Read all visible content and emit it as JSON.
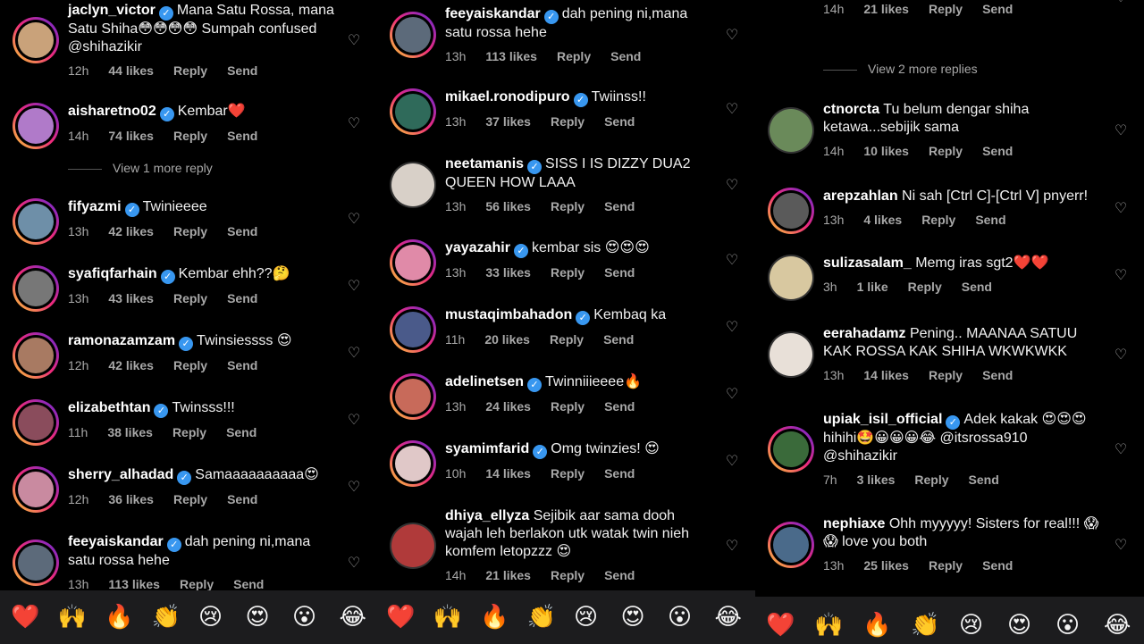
{
  "columns": [
    {
      "comments": [
        {
          "username": "jaclyn_victor",
          "verified": true,
          "text": "Mana Satu Rossa, mana Satu Shiha😳😳😳😳 Sumpah confused @shihazikir",
          "time": "12h",
          "likes": "44 likes",
          "reply": "Reply",
          "send": "Send",
          "avatar_color": "#c9a27a"
        },
        {
          "username": "aisharetno02",
          "verified": true,
          "text": "Kembar❤️",
          "time": "14h",
          "likes": "74 likes",
          "reply": "Reply",
          "send": "Send",
          "avatar_color": "#b07ac9"
        },
        {
          "more_replies": "View 1 more reply"
        },
        {
          "username": "fifyazmi",
          "verified": true,
          "text": "Twinieeee",
          "time": "13h",
          "likes": "42 likes",
          "reply": "Reply",
          "send": "Send",
          "avatar_color": "#6e8fa8"
        },
        {
          "username": "syafiqfarhain",
          "verified": true,
          "text": "Kembar ehh??🤔",
          "time": "13h",
          "likes": "43 likes",
          "reply": "Reply",
          "send": "Send",
          "avatar_color": "#777777"
        },
        {
          "username": "ramonazamzam",
          "verified": true,
          "text": "Twinsiessss 😍",
          "time": "12h",
          "likes": "42 likes",
          "reply": "Reply",
          "send": "Send",
          "avatar_color": "#a87a62"
        },
        {
          "username": "elizabethtan",
          "verified": true,
          "text": "Twinsss!!!",
          "time": "11h",
          "likes": "38 likes",
          "reply": "Reply",
          "send": "Send",
          "avatar_color": "#8a4c5c"
        },
        {
          "username": "sherry_alhadad",
          "verified": true,
          "text": "Samaaaaaaaaaa😍",
          "time": "12h",
          "likes": "36 likes",
          "reply": "Reply",
          "send": "Send",
          "avatar_color": "#c98aa0"
        },
        {
          "username": "feeyaiskandar",
          "verified": true,
          "text": "dah pening ni,mana satu rossa hehe",
          "time": "13h",
          "likes": "113 likes",
          "reply": "Reply",
          "send": "Send",
          "avatar_color": "#5c6a7a"
        }
      ]
    },
    {
      "comments": [
        {
          "username": "feeyaiskandar",
          "verified": true,
          "text": "dah pening ni,mana satu rossa hehe",
          "time": "13h",
          "likes": "113 likes",
          "reply": "Reply",
          "send": "Send",
          "avatar_color": "#5c6a7a"
        },
        {
          "username": "mikael.ronodipuro",
          "verified": true,
          "text": "Twiinss!!",
          "time": "13h",
          "likes": "37 likes",
          "reply": "Reply",
          "send": "Send",
          "avatar_color": "#2f6a5a"
        },
        {
          "username": "neetamanis",
          "verified": true,
          "text": "SISS I IS DIZZY DUA2 QUEEN HOW LAAA",
          "time": "13h",
          "likes": "56 likes",
          "reply": "Reply",
          "send": "Send",
          "avatar_color": "#d8d0c8",
          "plain": true
        },
        {
          "username": "yayazahir",
          "verified": true,
          "text": "kembar sis 😍😍😍",
          "time": "13h",
          "likes": "33 likes",
          "reply": "Reply",
          "send": "Send",
          "avatar_color": "#e08aa8"
        },
        {
          "username": "mustaqimbahadon",
          "verified": true,
          "text": "Kembaq ka",
          "time": "11h",
          "likes": "20 likes",
          "reply": "Reply",
          "send": "Send",
          "avatar_color": "#4a5a8a"
        },
        {
          "username": "adelinetsen",
          "verified": true,
          "text": "Twinniiieeee🔥",
          "time": "13h",
          "likes": "24 likes",
          "reply": "Reply",
          "send": "Send",
          "avatar_color": "#c86a5a"
        },
        {
          "username": "syamimfarid",
          "verified": true,
          "text": "Omg twinzies! 😍",
          "time": "10h",
          "likes": "14 likes",
          "reply": "Reply",
          "send": "Send",
          "avatar_color": "#e0c8c8"
        },
        {
          "username": "dhiya_ellyza",
          "verified": false,
          "text": "Sejibik aar sama dooh wajah leh berlakon utk watak twin nieh komfem letopzzz 😍",
          "time": "14h",
          "likes": "21 likes",
          "reply": "Reply",
          "send": "Send",
          "avatar_color": "#b03a3a",
          "plain": true
        }
      ]
    },
    {
      "comments": [
        {
          "username": "",
          "verified": false,
          "text": "komfem letopzzz 😍",
          "time": "14h",
          "likes": "21 likes",
          "reply": "Reply",
          "send": "Send"
        },
        {
          "more_replies": "View 2 more replies"
        },
        {
          "username": "ctnorcta",
          "verified": false,
          "text": "Tu belum dengar shiha ketawa...sebijik sama",
          "time": "14h",
          "likes": "10 likes",
          "reply": "Reply",
          "send": "Send",
          "avatar_color": "#6a8a5a",
          "plain": true
        },
        {
          "username": "arepzahlan",
          "verified": false,
          "text": "Ni sah [Ctrl C]-[Ctrl V] pnyerr!",
          "time": "13h",
          "likes": "4 likes",
          "reply": "Reply",
          "send": "Send",
          "avatar_color": "#5a5a5a"
        },
        {
          "username": "sulizasalam_",
          "verified": false,
          "text": "Memg iras sgt2❤️❤️",
          "time": "3h",
          "likes": "1 like",
          "reply": "Reply",
          "send": "Send",
          "avatar_color": "#d8c8a0",
          "plain": true
        },
        {
          "username": "eerahadamz",
          "verified": false,
          "text": "Pening.. MAANAA SATUU KAK ROSSA KAK SHIHA WKWKWKK",
          "time": "13h",
          "likes": "14 likes",
          "reply": "Reply",
          "send": "Send",
          "avatar_color": "#e8e0d8",
          "plain": true
        },
        {
          "username": "upiak_isil_official",
          "verified": true,
          "text": "Adek kakak 😍😍😍 hihihi🤩😀😀😀😂 @itsrossa910 @shihazikir",
          "time": "7h",
          "likes": "3 likes",
          "reply": "Reply",
          "send": "Send",
          "avatar_color": "#3a6a3a"
        },
        {
          "username": "nephiaxe",
          "verified": false,
          "text": "Ohh myyyyy! Sisters for real!!! 😱😱 love you both",
          "time": "13h",
          "likes": "25 likes",
          "reply": "Reply",
          "send": "Send",
          "avatar_color": "#4a6a8a"
        }
      ]
    }
  ],
  "emoji_bar": [
    "❤️",
    "🙌",
    "🔥",
    "👏",
    "😢",
    "😍",
    "😮",
    "😂"
  ]
}
